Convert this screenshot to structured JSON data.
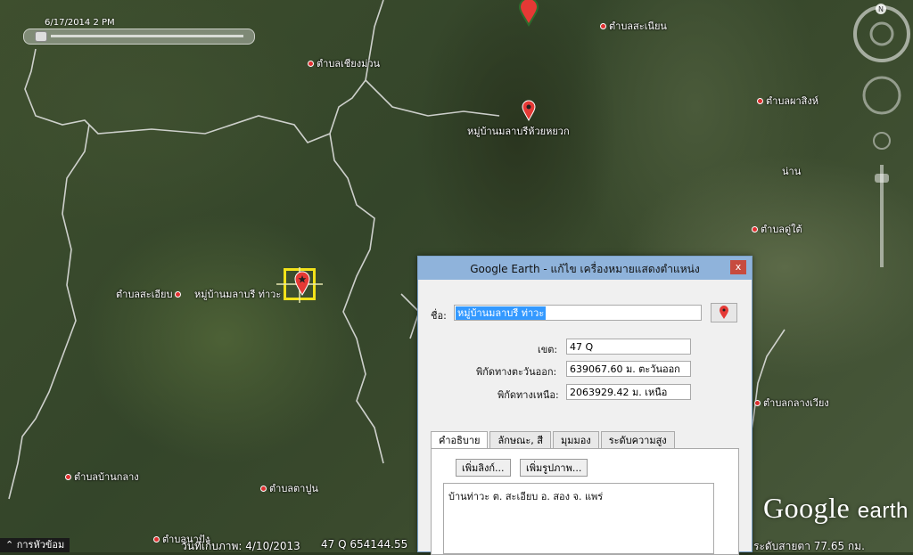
{
  "time_slider": {
    "label": "6/17/2014    2 PM"
  },
  "places": [
    {
      "name": "ตำบลเชียงม่วน"
    },
    {
      "name": "ตำบลสะเนียน"
    },
    {
      "name": "ตำบลผาสิงห์"
    },
    {
      "name": "หมู่บ้านมลาบรีห้วยหยวก"
    },
    {
      "name": "น่าน"
    },
    {
      "name": "ตำบลดู่ใต้"
    },
    {
      "name": "ตำบลสะเอียบ"
    },
    {
      "name": "หมู่บ้านมลาบรี ท่าวะ"
    },
    {
      "name": "ตำบลกลางเวียง"
    },
    {
      "name": "ตำบลบ้านกลาง"
    },
    {
      "name": "ตำบลตาปูน"
    },
    {
      "name": "ตำบลนาปัง"
    }
  ],
  "logo": {
    "google": "Google",
    "earth": "earth"
  },
  "status_bar": {
    "expander": "การหัวข้อม",
    "imagery_date": "วันที่เก็บภาพ: 4/10/2013",
    "coords": "47 Q 654144.55",
    "eye_alt": "ระดับสายตา  77.65 กม."
  },
  "dialog": {
    "title": "Google Earth - แก้ไข  เครื่องหมายแสดงตำแหน่ง",
    "close": "x",
    "name_label": "ชื่อ:",
    "name_value": "หมู่บ้านมลาบรี ท่าวะ",
    "zone_label": "เขต:",
    "zone_value": "47 Q",
    "easting_label": "พิกัดทางตะวันออก:",
    "easting_value": "639067.60 ม. ตะวันออก",
    "northing_label": "พิกัดทางเหนือ:",
    "northing_value": "2063929.42 ม. เหนือ",
    "tabs": [
      {
        "label": "คำอธิบาย"
      },
      {
        "label": "ลักษณะ, สี"
      },
      {
        "label": "มุมมอง"
      },
      {
        "label": "ระดับความสูง"
      }
    ],
    "add_link": "เพิ่มลิงก์...",
    "add_image": "เพิ่มรูปภาพ...",
    "description": "บ้านท่าวะ ต. สะเอียบ อ. สอง จ. แพร่"
  }
}
